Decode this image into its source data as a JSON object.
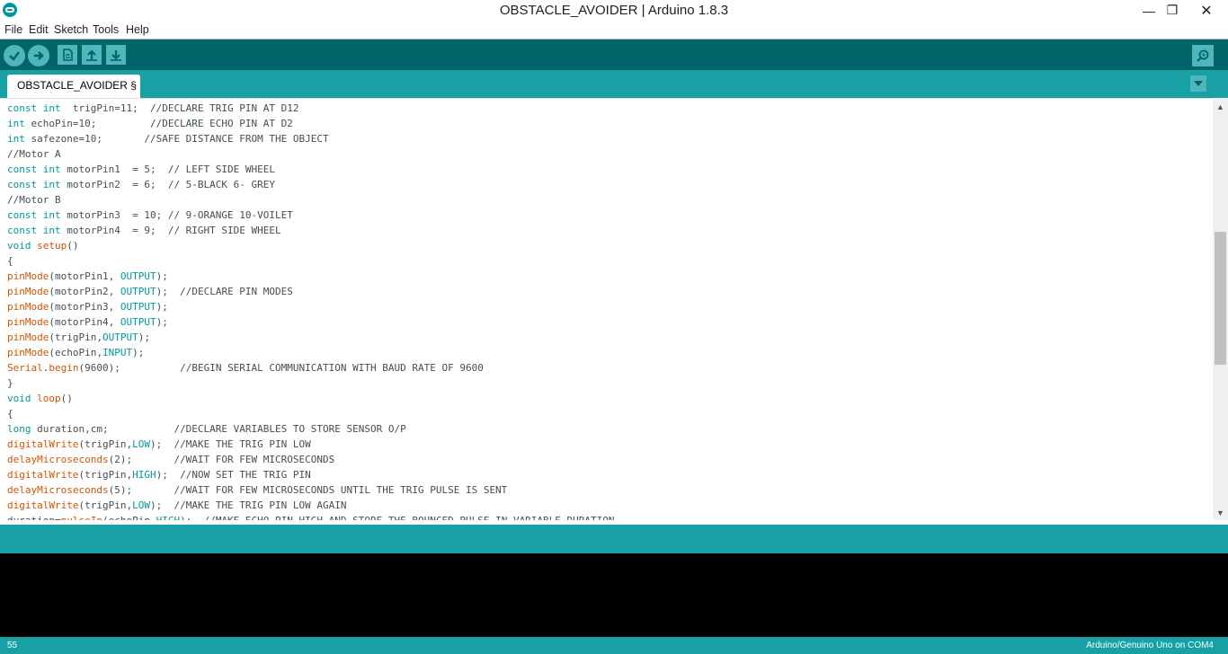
{
  "window": {
    "title": "OBSTACLE_AVOIDER | Arduino 1.8.3",
    "minimize": "—",
    "maximize": "❐",
    "close": "✕"
  },
  "menu": [
    "File",
    "Edit",
    "Sketch",
    "Tools",
    "Help"
  ],
  "toolbar": {
    "buttons": [
      "verify-icon",
      "upload-icon",
      "new-icon",
      "open-icon",
      "save-icon"
    ],
    "serial_monitor": "serial-monitor-icon"
  },
  "tab": {
    "label": "OBSTACLE_AVOIDER §"
  },
  "code": [
    [
      [
        "kw",
        "const int"
      ],
      [
        "",
        "  trigPin=11;  //DECLARE TRIG PIN AT D12"
      ]
    ],
    [
      [
        "kw",
        "int"
      ],
      [
        "",
        " echoPin=10;         //DECLARE ECHO PIN AT D2"
      ]
    ],
    [
      [
        "kw",
        "int"
      ],
      [
        "",
        " safezone=10;       //SAFE DISTANCE FROM THE OBJECT"
      ]
    ],
    [
      [
        "",
        "//Motor A"
      ]
    ],
    [
      [
        "kw",
        "const int"
      ],
      [
        "",
        " motorPin1  = 5;  // LEFT SIDE WHEEL"
      ]
    ],
    [
      [
        "kw",
        "const int"
      ],
      [
        "",
        " motorPin2  = 6;  // 5-BLACK 6- GREY"
      ]
    ],
    [
      [
        "",
        "//Motor B"
      ]
    ],
    [
      [
        "kw",
        "const int"
      ],
      [
        "",
        " motorPin3  = 10; // 9-ORANGE 10-VOILET"
      ]
    ],
    [
      [
        "kw",
        "const int"
      ],
      [
        "",
        " motorPin4  = 9;  // RIGHT SIDE WHEEL"
      ]
    ],
    [
      [
        "kw",
        "void"
      ],
      [
        "",
        " "
      ],
      [
        "fn",
        "setup"
      ],
      [
        "",
        "()"
      ]
    ],
    [
      [
        "",
        "{"
      ]
    ],
    [
      [
        "fn",
        "pinMode"
      ],
      [
        "",
        "(motorPin1, "
      ],
      [
        "kw",
        "OUTPUT"
      ],
      [
        "",
        ");"
      ]
    ],
    [
      [
        "fn",
        "pinMode"
      ],
      [
        "",
        "(motorPin2, "
      ],
      [
        "kw",
        "OUTPUT"
      ],
      [
        "",
        ");  //DECLARE PIN MODES"
      ]
    ],
    [
      [
        "fn",
        "pinMode"
      ],
      [
        "",
        "(motorPin3, "
      ],
      [
        "kw",
        "OUTPUT"
      ],
      [
        "",
        ");"
      ]
    ],
    [
      [
        "fn",
        "pinMode"
      ],
      [
        "",
        "(motorPin4, "
      ],
      [
        "kw",
        "OUTPUT"
      ],
      [
        "",
        ");"
      ]
    ],
    [
      [
        "fn",
        "pinMode"
      ],
      [
        "",
        "(trigPin,"
      ],
      [
        "kw",
        "OUTPUT"
      ],
      [
        "",
        ");"
      ]
    ],
    [
      [
        "fn",
        "pinMode"
      ],
      [
        "",
        "(echoPin,"
      ],
      [
        "kw",
        "INPUT"
      ],
      [
        "",
        ");"
      ]
    ],
    [
      [
        "fn",
        "Serial"
      ],
      [
        "",
        "."
      ],
      [
        "fn",
        "begin"
      ],
      [
        "",
        "(9600);          //BEGIN SERIAL COMMUNICATION WITH BAUD RATE OF 9600"
      ]
    ],
    [
      [
        "",
        "}"
      ]
    ],
    [
      [
        "kw",
        "void"
      ],
      [
        "",
        " "
      ],
      [
        "fn",
        "loop"
      ],
      [
        "",
        "()"
      ]
    ],
    [
      [
        "",
        "{"
      ]
    ],
    [
      [
        "kw",
        "long"
      ],
      [
        "",
        " duration,cm;           //DECLARE VARIABLES TO STORE SENSOR O/P"
      ]
    ],
    [
      [
        "fn",
        "digitalWrite"
      ],
      [
        "",
        "(trigPin,"
      ],
      [
        "kw",
        "LOW"
      ],
      [
        "",
        ");  //MAKE THE TRIG PIN LOW"
      ]
    ],
    [
      [
        "fn",
        "delayMicroseconds"
      ],
      [
        "",
        "(2);       //WAIT FOR FEW MICROSECONDS"
      ]
    ],
    [
      [
        "fn",
        "digitalWrite"
      ],
      [
        "",
        "(trigPin,"
      ],
      [
        "kw",
        "HIGH"
      ],
      [
        "",
        ");  //NOW SET THE TRIG PIN"
      ]
    ],
    [
      [
        "fn",
        "delayMicroseconds"
      ],
      [
        "",
        "(5);       //WAIT FOR FEW MICROSECONDS UNTIL THE TRIG PULSE IS SENT"
      ]
    ],
    [
      [
        "fn",
        "digitalWrite"
      ],
      [
        "",
        "(trigPin,"
      ],
      [
        "kw",
        "LOW"
      ],
      [
        "",
        ");  //MAKE THE TRIG PIN LOW AGAIN"
      ]
    ],
    [
      [
        "",
        "duration="
      ],
      [
        "fn",
        "pulseIn"
      ],
      [
        "",
        "(echoPin,"
      ],
      [
        "kw",
        "HIGH"
      ],
      [
        "",
        ");  //MAKE ECHO PIN HIGH AND STORE THE BOUNCED PULSE IN VARIABLE DURATION"
      ]
    ]
  ],
  "footer": {
    "line_number": "55",
    "board": "Arduino/Genuino Uno on COM4"
  },
  "colors": {
    "toolbar": "#006468",
    "tabbar": "#17a1a5",
    "keyword": "#00979c",
    "function": "#d35400"
  }
}
